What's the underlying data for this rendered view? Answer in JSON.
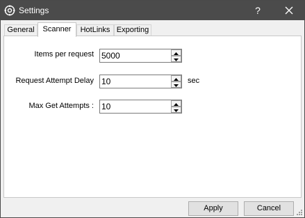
{
  "window": {
    "title": "Settings",
    "help_label": "?",
    "title_icon": "gear-icon",
    "close_icon": "close-icon"
  },
  "tabs": [
    {
      "label": "General",
      "active": false
    },
    {
      "label": "Scanner",
      "active": true
    },
    {
      "label": "HotLinks",
      "active": false
    },
    {
      "label": "Exporting",
      "active": false
    }
  ],
  "scanner": {
    "items_per_request": {
      "label": "Items per request",
      "value": "5000"
    },
    "request_attempt_delay": {
      "label": "Request Attempt Delay",
      "value": "10",
      "unit": "sec"
    },
    "max_get_attempts": {
      "label": "Max Get Attempts :",
      "value": "10"
    }
  },
  "footer": {
    "apply_label": "Apply",
    "cancel_label": "Cancel"
  },
  "colors": {
    "titlebar": "#4b4b4b",
    "panel": "#ffffff",
    "window_bg": "#f0f0f0"
  }
}
